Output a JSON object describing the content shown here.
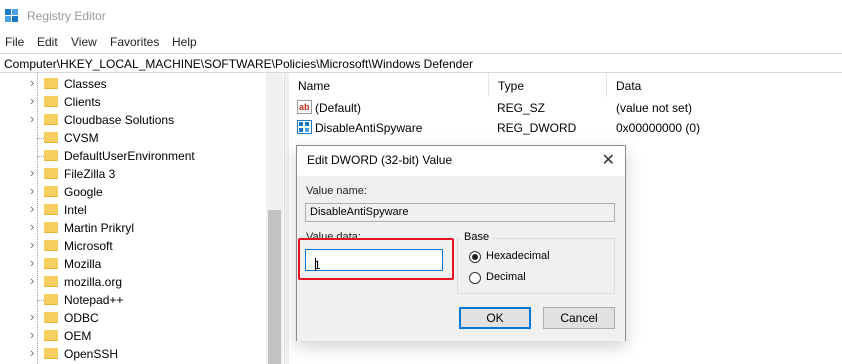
{
  "window": {
    "title": "Registry Editor"
  },
  "menu": [
    "File",
    "Edit",
    "View",
    "Favorites",
    "Help"
  ],
  "address": "Computer\\HKEY_LOCAL_MACHINE\\SOFTWARE\\Policies\\Microsoft\\Windows Defender",
  "tree": {
    "items": [
      {
        "label": "Classes",
        "expandable": true
      },
      {
        "label": "Clients",
        "expandable": true
      },
      {
        "label": "Cloudbase Solutions",
        "expandable": true
      },
      {
        "label": "CVSM",
        "expandable": false
      },
      {
        "label": "DefaultUserEnvironment",
        "expandable": false
      },
      {
        "label": "FileZilla 3",
        "expandable": true
      },
      {
        "label": "Google",
        "expandable": true
      },
      {
        "label": "Intel",
        "expandable": true
      },
      {
        "label": "Martin Prikryl",
        "expandable": true
      },
      {
        "label": "Microsoft",
        "expandable": true
      },
      {
        "label": "Mozilla",
        "expandable": true
      },
      {
        "label": "mozilla.org",
        "expandable": true
      },
      {
        "label": "Notepad++",
        "expandable": false
      },
      {
        "label": "ODBC",
        "expandable": true
      },
      {
        "label": "OEM",
        "expandable": true
      },
      {
        "label": "OpenSSH",
        "expandable": true
      }
    ]
  },
  "list": {
    "columns": [
      "Name",
      "Type",
      "Data"
    ],
    "rows": [
      {
        "icon": "string-value-icon",
        "name": "(Default)",
        "type": "REG_SZ",
        "data": "(value not set)"
      },
      {
        "icon": "binary-value-icon",
        "name": "DisableAntiSpyware",
        "type": "REG_DWORD",
        "data": "0x00000000 (0)"
      }
    ]
  },
  "dialog": {
    "title": "Edit DWORD (32-bit) Value",
    "value_name_label": "Value name:",
    "value_name": "DisableAntiSpyware",
    "value_data_label": "Value data:",
    "value_data": "1",
    "base_label": "Base",
    "base_options": [
      {
        "label": "Hexadecimal",
        "selected": true
      },
      {
        "label": "Decimal",
        "selected": false
      }
    ],
    "ok_label": "OK",
    "cancel_label": "Cancel"
  },
  "colors": {
    "accent": "#0078d7",
    "highlight": "#e81123",
    "folder": "#f6cf5f"
  }
}
